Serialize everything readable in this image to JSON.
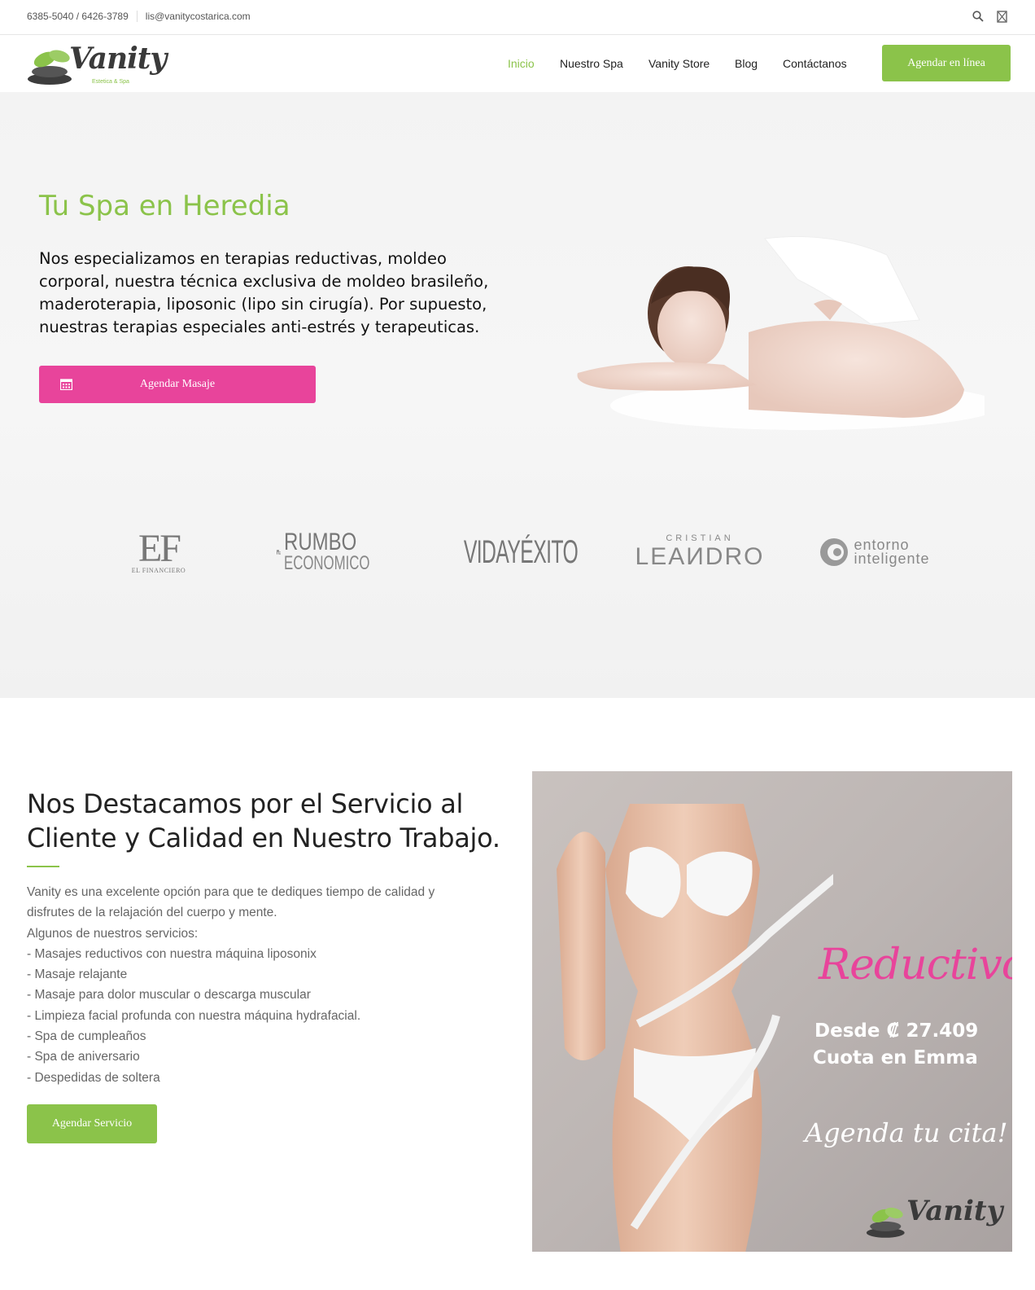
{
  "topbar": {
    "phones": "6385-5040 / 6426-3789",
    "email": "lis@vanitycostarica.com"
  },
  "header": {
    "logo_text": "Vanity",
    "logo_sub": "Estetica & Spa",
    "nav": [
      {
        "label": "Inicio",
        "active": true
      },
      {
        "label": "Nuestro Spa",
        "active": false
      },
      {
        "label": "Vanity Store",
        "active": false
      },
      {
        "label": "Blog",
        "active": false
      },
      {
        "label": "Contáctanos",
        "active": false
      }
    ],
    "cta_label": "Agendar en línea"
  },
  "hero": {
    "title": "Tu Spa en Heredia",
    "text": "Nos especializamos en terapias reductivas, moldeo corporal, nuestra técnica exclusiva de moldeo brasileño, maderoterapia, liposonic (lipo sin cirugía). Por supuesto, nuestras terapias especiales anti-estrés y terapeuticas.",
    "button_label": "Agendar Masaje"
  },
  "press": {
    "ef_big": "EF",
    "ef_small": "EL FINANCIERO",
    "rumbo_1": "RUMBO",
    "rumbo_2": "ECONOMICO",
    "vida": "VIDAYÉXITO",
    "leandro_1": "CRISTIAN",
    "leandro_2": "LEAИDRO",
    "entorno_1": "entorno",
    "entorno_2": "inteligente"
  },
  "section2": {
    "title": "Nos Destacamos por el Servicio al Cliente y Calidad en Nuestro Trabajo.",
    "intro": "Vanity es una excelente opción para que te dediques tiempo de calidad y disfrutes de la relajación del cuerpo y mente.",
    "list_title": "Algunos de nuestros servicios:",
    "services": [
      "- Masajes reductivos con nuestra máquina liposonix",
      "- Masaje relajante",
      "- Masaje para dolor muscular o descarga muscular",
      "- Limpieza facial profunda con nuestra máquina hydrafacial.",
      "- Spa de cumpleaños",
      "- Spa de aniversario",
      "- Despedidas de soltera"
    ],
    "button_label": "Agendar Servicio"
  },
  "promo": {
    "title": "Reductivo",
    "price": "Desde ₡ 27.409",
    "quota": "Cuota en Emma",
    "cta": "Agenda tu cita!",
    "logo_text": "Vanity"
  },
  "colors": {
    "accent_green": "#8bc34a",
    "accent_pink": "#e8449b"
  }
}
